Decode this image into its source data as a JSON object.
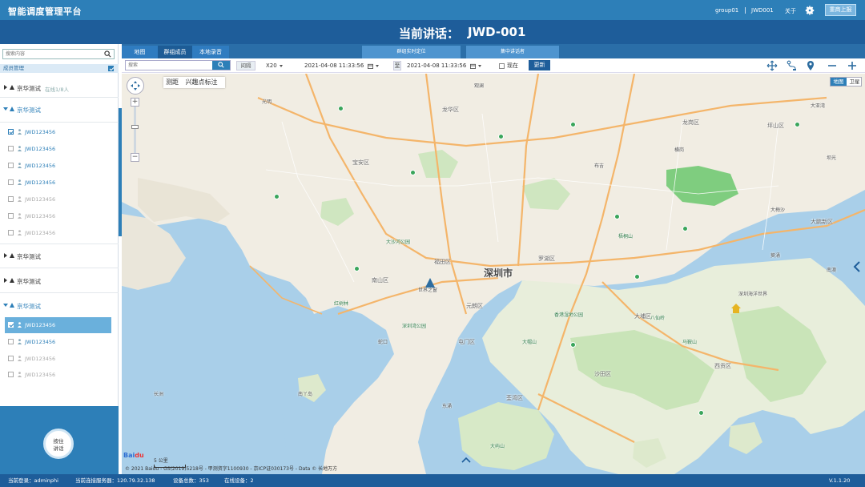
{
  "app": {
    "title": "智能调度管理平台",
    "user": "group01",
    "station": "JWD001",
    "about_label": "关于",
    "settings_icon": "gear-icon",
    "report_button": "重商上报"
  },
  "header": {
    "talk_label": "当前讲话：",
    "talk_value": "JWD-001"
  },
  "sidebar": {
    "search_placeholder": "搜索内容",
    "search_icon": "search-icon",
    "group_bar_label": "成员管理",
    "groups": [
      {
        "name": "京华测试",
        "count": "在线1/8人",
        "expanded": false
      },
      {
        "name": "京华测试",
        "expanded": true,
        "devices": [
          {
            "name": "JWD123456",
            "checked": true,
            "online": true
          },
          {
            "name": "JWD123456",
            "checked": false,
            "online": true
          },
          {
            "name": "JWD123456",
            "checked": false,
            "online": true
          },
          {
            "name": "JWD123456",
            "checked": false,
            "online": true
          },
          {
            "name": "JWD123456",
            "checked": false,
            "online": false
          },
          {
            "name": "JWD123456",
            "checked": false,
            "online": false
          },
          {
            "name": "JWD123456",
            "checked": false,
            "online": false
          }
        ]
      },
      {
        "name": "京华测试",
        "expanded": false
      },
      {
        "name": "京华测试",
        "expanded": false
      },
      {
        "name": "京华测试",
        "expanded": true,
        "devices": [
          {
            "name": "JWD123456",
            "checked": true,
            "online": true,
            "selected": true
          },
          {
            "name": "JWD123456",
            "checked": false,
            "online": true
          },
          {
            "name": "JWD123456",
            "checked": false,
            "online": false
          },
          {
            "name": "JWD123456",
            "checked": false,
            "online": false
          }
        ]
      }
    ],
    "ptt_button": [
      "按住",
      "讲话"
    ]
  },
  "tabs": [
    "地图",
    "群组成员",
    "本地录音",
    "群组实时定位",
    "集中讲话者"
  ],
  "toolbar": {
    "search_placeholder": "搜索",
    "interval_label": "间隔",
    "speed": "X20",
    "start_time": "2021-04-08 11:33:56",
    "tilde": "至",
    "end_time": "2021-04-08 11:33:56",
    "now_label": "现在",
    "refresh_label": "更新",
    "icons": [
      "move-icon",
      "route-icon",
      "location-pin-icon",
      "zoom-out-icon",
      "zoom-in-icon"
    ]
  },
  "map": {
    "tools": [
      "测距",
      "兴趣点标注"
    ],
    "type_map": "地图",
    "type_satellite": "卫星",
    "scale": "5 公里",
    "copyright": "© 2021 Baidu - GS(2019)5218号 - 甲测资字1100930 - 京ICP证030173号 - Data © 长地万方",
    "city_label": "深圳市",
    "labels": [
      "南山区",
      "宝安区",
      "福田区",
      "罗湖区",
      "龙华区",
      "龙岗区",
      "坪山区",
      "大鹏新区",
      "屯门区",
      "元朗区",
      "沙田区",
      "大埔区",
      "西贡区",
      "荃湾区",
      "深圳湾公园",
      "红树林",
      "世界之窗",
      "大沙河公园",
      "梧桐山",
      "深圳海洋世界",
      "大梅沙",
      "坝光",
      "香港湿地公园",
      "大帽山",
      "马鞍山",
      "八仙岭",
      "东涌",
      "南丫岛",
      "长洲",
      "大屿山",
      "葵涌",
      "南澳",
      "大亚湾",
      "蛇口",
      "布吉",
      "横岗",
      "观澜",
      "光明"
    ]
  },
  "status": {
    "login": "当前登录：adminphi",
    "server": "当前连接服务器：120.79.32.138",
    "devices": "设备总数：353",
    "online": "在线设备：2",
    "version": "V.1.1.20"
  }
}
